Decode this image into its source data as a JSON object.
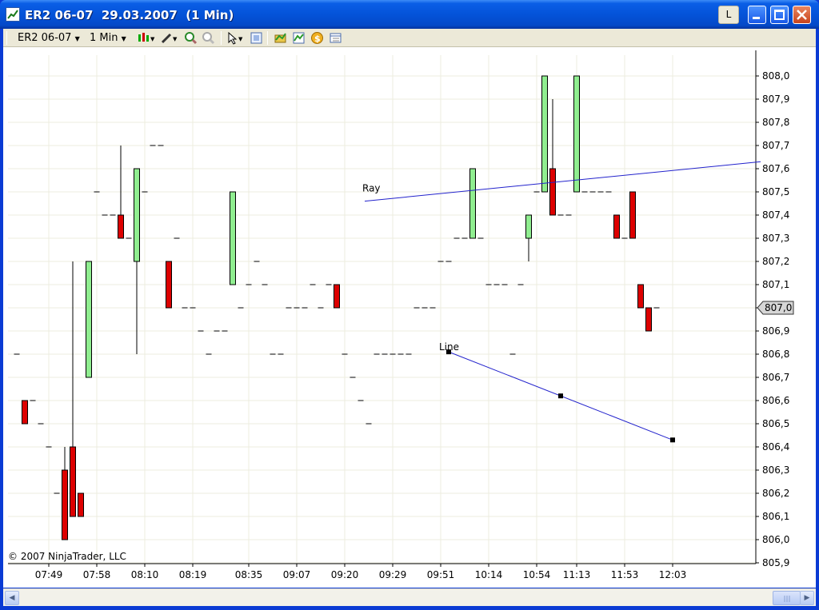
{
  "window": {
    "title": "ER2 06-07  29.03.2007  (1 Min)",
    "l_button": "L"
  },
  "toolbar": {
    "instrument": "ER2 06-07",
    "interval": "1 Min"
  },
  "chart": {
    "copyright": "© 2007 NinjaTrader, LLC",
    "current_price": "807,0",
    "y_ticks": [
      "808,0",
      "807,9",
      "807,8",
      "807,7",
      "807,6",
      "807,5",
      "807,4",
      "807,3",
      "807,2",
      "807,1",
      "807,0",
      "806,9",
      "806,8",
      "806,7",
      "806,6",
      "806,5",
      "806,4",
      "806,3",
      "806,2",
      "806,1",
      "806,0",
      "805,9"
    ],
    "x_ticks": [
      "07:49",
      "07:58",
      "08:10",
      "08:19",
      "08:35",
      "09:07",
      "09:20",
      "09:29",
      "09:51",
      "10:14",
      "10:54",
      "11:13",
      "11:53",
      "12:03"
    ],
    "annotations": {
      "ray": "Ray",
      "line": "Line"
    },
    "colors": {
      "up": "#90EE90",
      "down": "#DD0000",
      "drawing": "#2222CC",
      "grid": "#ECECDF"
    }
  },
  "chart_data": {
    "type": "candlestick",
    "ylim": [
      805.9,
      808.1
    ],
    "price_axis": "right",
    "candles": [
      {
        "o": 806.8,
        "h": 806.8,
        "l": 806.8,
        "c": 806.8
      },
      {
        "o": 806.6,
        "h": 806.6,
        "l": 806.5,
        "c": 806.5
      },
      {
        "o": 806.6,
        "h": 806.6,
        "l": 806.6,
        "c": 806.6
      },
      {
        "o": 806.5,
        "h": 806.5,
        "l": 806.5,
        "c": 806.5
      },
      {
        "o": 806.4,
        "h": 806.4,
        "l": 806.4,
        "c": 806.4
      },
      {
        "o": 806.2,
        "h": 806.2,
        "l": 806.2,
        "c": 806.2
      },
      {
        "o": 806.3,
        "h": 806.4,
        "l": 806.0,
        "c": 806.0
      },
      {
        "o": 806.4,
        "h": 807.2,
        "l": 806.1,
        "c": 806.1
      },
      {
        "o": 806.2,
        "h": 806.2,
        "l": 806.1,
        "c": 806.1
      },
      {
        "o": 806.7,
        "h": 807.2,
        "l": 806.7,
        "c": 807.2
      },
      {
        "o": 807.5,
        "h": 807.5,
        "l": 807.5,
        "c": 807.5
      },
      {
        "o": 807.4,
        "h": 807.4,
        "l": 807.4,
        "c": 807.4
      },
      {
        "o": 807.4,
        "h": 807.4,
        "l": 807.4,
        "c": 807.4
      },
      {
        "o": 807.4,
        "h": 807.7,
        "l": 807.3,
        "c": 807.3
      },
      {
        "o": 807.3,
        "h": 807.3,
        "l": 807.3,
        "c": 807.3
      },
      {
        "o": 807.2,
        "h": 807.6,
        "l": 806.8,
        "c": 807.6
      },
      {
        "o": 807.5,
        "h": 807.5,
        "l": 807.5,
        "c": 807.5
      },
      {
        "o": 807.7,
        "h": 807.7,
        "l": 807.7,
        "c": 807.7
      },
      {
        "o": 807.7,
        "h": 807.7,
        "l": 807.7,
        "c": 807.7
      },
      {
        "o": 807.2,
        "h": 807.2,
        "l": 807.0,
        "c": 807.0
      },
      {
        "o": 807.3,
        "h": 807.3,
        "l": 807.3,
        "c": 807.3
      },
      {
        "o": 807.0,
        "h": 807.0,
        "l": 807.0,
        "c": 807.0
      },
      {
        "o": 807.0,
        "h": 807.0,
        "l": 807.0,
        "c": 807.0
      },
      {
        "o": 806.9,
        "h": 806.9,
        "l": 806.9,
        "c": 806.9
      },
      {
        "o": 806.8,
        "h": 806.8,
        "l": 806.8,
        "c": 806.8
      },
      {
        "o": 806.9,
        "h": 806.9,
        "l": 806.9,
        "c": 806.9
      },
      {
        "o": 806.9,
        "h": 806.9,
        "l": 806.9,
        "c": 806.9
      },
      {
        "o": 807.1,
        "h": 807.5,
        "l": 807.1,
        "c": 807.5
      },
      {
        "o": 807.0,
        "h": 807.0,
        "l": 807.0,
        "c": 807.0
      },
      {
        "o": 807.1,
        "h": 807.1,
        "l": 807.1,
        "c": 807.1
      },
      {
        "o": 807.2,
        "h": 807.2,
        "l": 807.2,
        "c": 807.2
      },
      {
        "o": 807.1,
        "h": 807.1,
        "l": 807.1,
        "c": 807.1
      },
      {
        "o": 806.8,
        "h": 806.8,
        "l": 806.8,
        "c": 806.8
      },
      {
        "o": 806.8,
        "h": 806.8,
        "l": 806.8,
        "c": 806.8
      },
      {
        "o": 807.0,
        "h": 807.0,
        "l": 807.0,
        "c": 807.0
      },
      {
        "o": 807.0,
        "h": 807.0,
        "l": 807.0,
        "c": 807.0
      },
      {
        "o": 807.0,
        "h": 807.0,
        "l": 807.0,
        "c": 807.0
      },
      {
        "o": 807.1,
        "h": 807.1,
        "l": 807.1,
        "c": 807.1
      },
      {
        "o": 807.0,
        "h": 807.0,
        "l": 807.0,
        "c": 807.0
      },
      {
        "o": 807.1,
        "h": 807.1,
        "l": 807.1,
        "c": 807.1
      },
      {
        "o": 807.1,
        "h": 807.1,
        "l": 807.0,
        "c": 807.0
      },
      {
        "o": 806.8,
        "h": 806.8,
        "l": 806.8,
        "c": 806.8
      },
      {
        "o": 806.7,
        "h": 806.7,
        "l": 806.7,
        "c": 806.7
      },
      {
        "o": 806.6,
        "h": 806.6,
        "l": 806.6,
        "c": 806.6
      },
      {
        "o": 806.5,
        "h": 806.5,
        "l": 806.5,
        "c": 806.5
      },
      {
        "o": 806.8,
        "h": 806.8,
        "l": 806.8,
        "c": 806.8
      },
      {
        "o": 806.8,
        "h": 806.8,
        "l": 806.8,
        "c": 806.8
      },
      {
        "o": 806.8,
        "h": 806.8,
        "l": 806.8,
        "c": 806.8
      },
      {
        "o": 806.8,
        "h": 806.8,
        "l": 806.8,
        "c": 806.8
      },
      {
        "o": 806.8,
        "h": 806.8,
        "l": 806.8,
        "c": 806.8
      },
      {
        "o": 807.0,
        "h": 807.0,
        "l": 807.0,
        "c": 807.0
      },
      {
        "o": 807.0,
        "h": 807.0,
        "l": 807.0,
        "c": 807.0
      },
      {
        "o": 807.0,
        "h": 807.0,
        "l": 807.0,
        "c": 807.0
      },
      {
        "o": 807.2,
        "h": 807.2,
        "l": 807.2,
        "c": 807.2
      },
      {
        "o": 807.2,
        "h": 807.2,
        "l": 807.2,
        "c": 807.2
      },
      {
        "o": 807.3,
        "h": 807.3,
        "l": 807.3,
        "c": 807.3
      },
      {
        "o": 807.3,
        "h": 807.3,
        "l": 807.3,
        "c": 807.3
      },
      {
        "o": 807.3,
        "h": 807.6,
        "l": 807.3,
        "c": 807.6
      },
      {
        "o": 807.3,
        "h": 807.3,
        "l": 807.3,
        "c": 807.3
      },
      {
        "o": 807.1,
        "h": 807.1,
        "l": 807.1,
        "c": 807.1
      },
      {
        "o": 807.1,
        "h": 807.1,
        "l": 807.1,
        "c": 807.1
      },
      {
        "o": 807.1,
        "h": 807.1,
        "l": 807.1,
        "c": 807.1
      },
      {
        "o": 806.8,
        "h": 806.8,
        "l": 806.8,
        "c": 806.8
      },
      {
        "o": 807.1,
        "h": 807.1,
        "l": 807.1,
        "c": 807.1
      },
      {
        "o": 807.3,
        "h": 807.4,
        "l": 807.2,
        "c": 807.4
      },
      {
        "o": 807.5,
        "h": 807.5,
        "l": 807.5,
        "c": 807.5
      },
      {
        "o": 807.5,
        "h": 808.0,
        "l": 807.5,
        "c": 808.0
      },
      {
        "o": 807.6,
        "h": 807.9,
        "l": 807.4,
        "c": 807.4
      },
      {
        "o": 807.4,
        "h": 807.4,
        "l": 807.4,
        "c": 807.4
      },
      {
        "o": 807.4,
        "h": 807.4,
        "l": 807.4,
        "c": 807.4
      },
      {
        "o": 807.5,
        "h": 808.0,
        "l": 807.5,
        "c": 808.0
      },
      {
        "o": 807.5,
        "h": 807.5,
        "l": 807.5,
        "c": 807.5
      },
      {
        "o": 807.5,
        "h": 807.5,
        "l": 807.5,
        "c": 807.5
      },
      {
        "o": 807.5,
        "h": 807.5,
        "l": 807.5,
        "c": 807.5
      },
      {
        "o": 807.5,
        "h": 807.5,
        "l": 807.5,
        "c": 807.5
      },
      {
        "o": 807.4,
        "h": 807.4,
        "l": 807.3,
        "c": 807.3
      },
      {
        "o": 807.3,
        "h": 807.3,
        "l": 807.3,
        "c": 807.3
      },
      {
        "o": 807.5,
        "h": 807.5,
        "l": 807.3,
        "c": 807.3
      },
      {
        "o": 807.1,
        "h": 807.1,
        "l": 807.0,
        "c": 807.0
      },
      {
        "o": 807.0,
        "h": 807.0,
        "l": 806.9,
        "c": 806.9
      },
      {
        "o": 807.0,
        "h": 807.0,
        "l": 807.0,
        "c": 807.0
      }
    ],
    "x_tick_bars": [
      4,
      10,
      16,
      22,
      29,
      35,
      41,
      47,
      53,
      59,
      65,
      70,
      76,
      82
    ],
    "ray": {
      "start_bar": 43.5,
      "start_price": 807.46,
      "end_bar": 93,
      "end_price": 807.63
    },
    "line": {
      "points": [
        {
          "bar": 54,
          "price": 806.81
        },
        {
          "bar": 68,
          "price": 806.62
        },
        {
          "bar": 82,
          "price": 806.43
        }
      ]
    }
  }
}
